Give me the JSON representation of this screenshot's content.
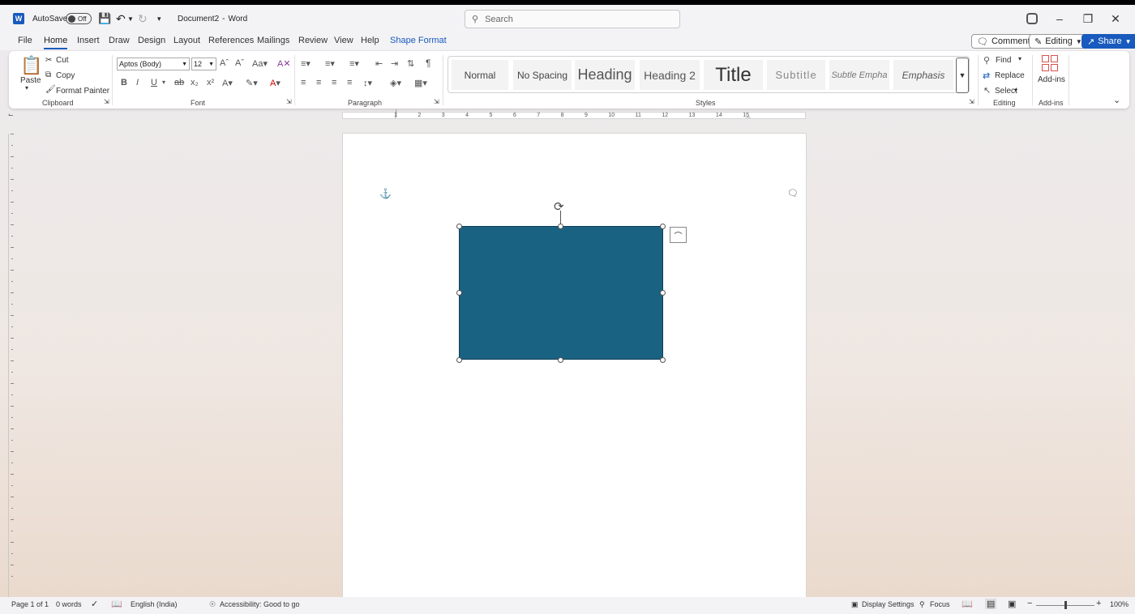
{
  "titlebar": {
    "autosave_label": "AutoSave",
    "autosave_state": "Off",
    "doc_title": "Document2",
    "separator": "-",
    "app_name": "Word",
    "search_placeholder": "Search"
  },
  "menubar": {
    "tabs": [
      {
        "label": "File"
      },
      {
        "label": "Home"
      },
      {
        "label": "Insert"
      },
      {
        "label": "Draw"
      },
      {
        "label": "Design"
      },
      {
        "label": "Layout"
      },
      {
        "label": "References"
      },
      {
        "label": "Mailings"
      },
      {
        "label": "Review"
      },
      {
        "label": "View"
      },
      {
        "label": "Help"
      },
      {
        "label": "Shape Format"
      }
    ],
    "comments_label": "Comments",
    "editing_label": "Editing",
    "share_label": "Share"
  },
  "ribbon": {
    "clipboard": {
      "paste_label": "Paste",
      "cut_label": "Cut",
      "copy_label": "Copy",
      "format_painter_label": "Format Painter",
      "group_label": "Clipboard"
    },
    "font": {
      "font_name": "Aptos (Body)",
      "font_size": "12",
      "group_label": "Font"
    },
    "paragraph": {
      "group_label": "Paragraph"
    },
    "styles": {
      "items": [
        {
          "label": "Normal"
        },
        {
          "label": "No Spacing"
        },
        {
          "label": "Heading"
        },
        {
          "label": "Heading 2"
        },
        {
          "label": "Title"
        },
        {
          "label": "Subtitle"
        },
        {
          "label": "Subtle Empha"
        },
        {
          "label": "Emphasis"
        }
      ],
      "group_label": "Styles"
    },
    "editing": {
      "find_label": "Find",
      "replace_label": "Replace",
      "select_label": "Select",
      "group_label": "Editing"
    },
    "addins": {
      "button_label": "Add-ins",
      "group_label": "Add-ins"
    }
  },
  "ruler": {
    "ticks": [
      "1",
      "2",
      "3",
      "4",
      "5",
      "6",
      "7",
      "8",
      "9",
      "10",
      "11",
      "12",
      "13",
      "14",
      "15"
    ]
  },
  "document": {
    "shape_fill": "#1a6282"
  },
  "statusbar": {
    "page_info": "Page 1 of 1",
    "word_count": "0 words",
    "language": "English (India)",
    "accessibility": "Accessibility: Good to go",
    "display_settings": "Display Settings",
    "focus": "Focus",
    "zoom": "100%"
  }
}
